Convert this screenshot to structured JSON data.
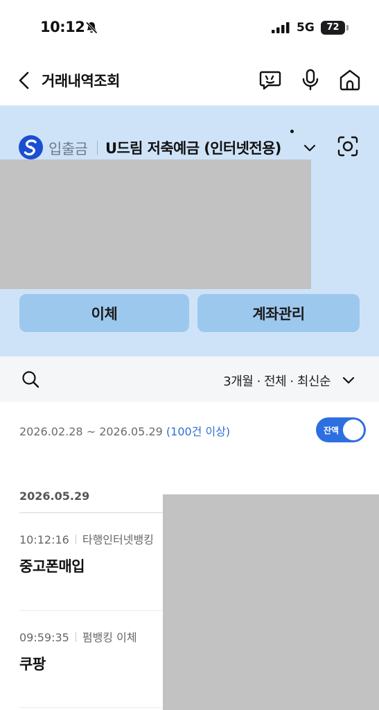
{
  "status_bar": {
    "time": "10:12",
    "network": "5G",
    "battery": "72"
  },
  "header": {
    "title": "거래내역조회"
  },
  "account": {
    "type": "입출금",
    "name": "U드림 저축예금 (인터넷전용)",
    "buttons": {
      "transfer": "이체",
      "manage": "계좌관리"
    },
    "colors": {
      "background": "#cfe3f8",
      "button": "#9dc8ee",
      "logo": "#1a4fd1"
    }
  },
  "filter": {
    "label": "3개월 · 전체 · 최신순"
  },
  "range": {
    "dates": "2026.02.28 ~ 2026.05.29",
    "count": "(100건 이상)",
    "toggle_label": "잔액",
    "toggle_on": true
  },
  "list": {
    "date": "2026.05.29",
    "transactions": [
      {
        "time": "10:12:16",
        "channel": "타행인터넷뱅킹",
        "name": "중고폰매입"
      },
      {
        "time": "09:59:35",
        "channel": "펌뱅킹 이체",
        "name": "쿠팡"
      }
    ]
  },
  "icons": [
    "back-chevron-icon",
    "chatbot-icon",
    "microphone-icon",
    "home-icon",
    "bank-logo-icon",
    "chevron-down-icon",
    "scan-icon",
    "search-icon",
    "bell-off-icon",
    "signal-icon"
  ]
}
